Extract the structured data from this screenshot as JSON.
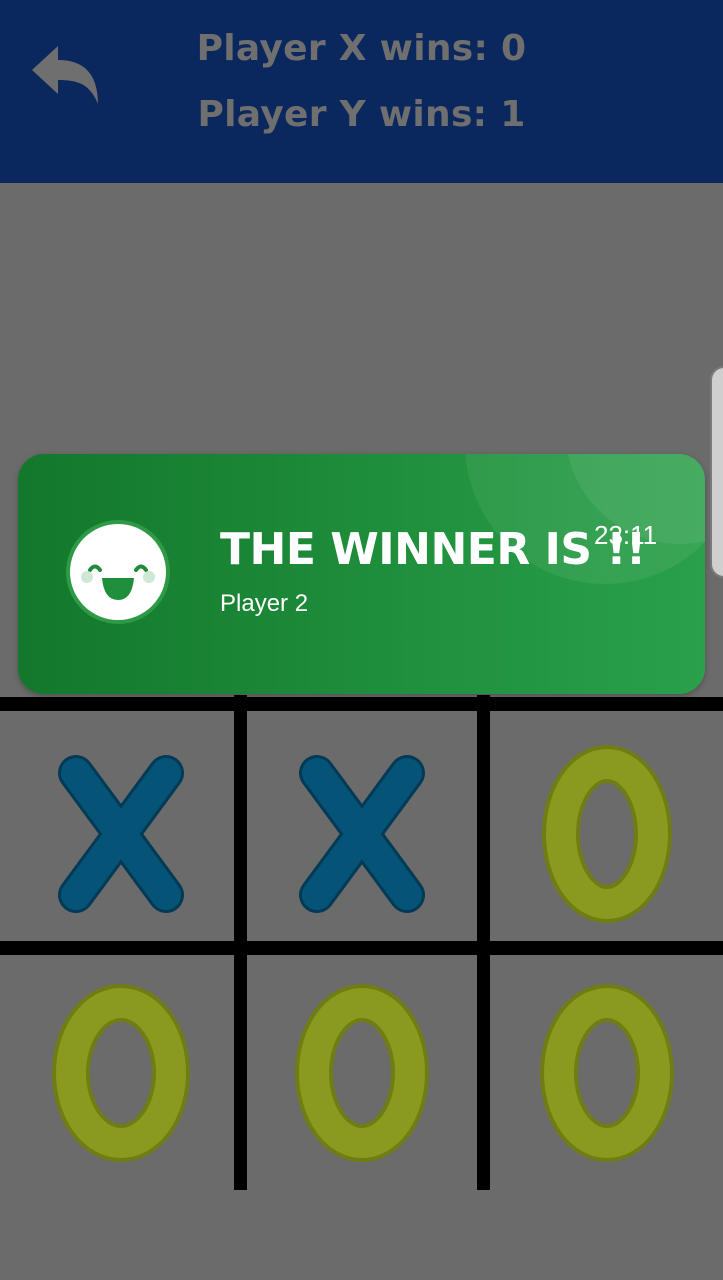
{
  "header": {
    "player_x_score": "Player X wins: 0",
    "player_y_score": "Player Y wins: 1"
  },
  "board": {
    "cells": [
      "X",
      "X",
      "O",
      "O",
      "O",
      "O"
    ]
  },
  "notification": {
    "title": "THE WINNER IS !!",
    "time": "23:11",
    "message": "Player 2"
  },
  "colors": {
    "header_bg": "#0b285e",
    "overlay_bg": "#6b6b6b",
    "x_mark": "#055478",
    "o_mark": "#8a9a1e",
    "toast_green": "#1f8f3b"
  },
  "icons": {
    "back": "undo-arrow-icon",
    "smiley": "smiley-face-icon"
  }
}
